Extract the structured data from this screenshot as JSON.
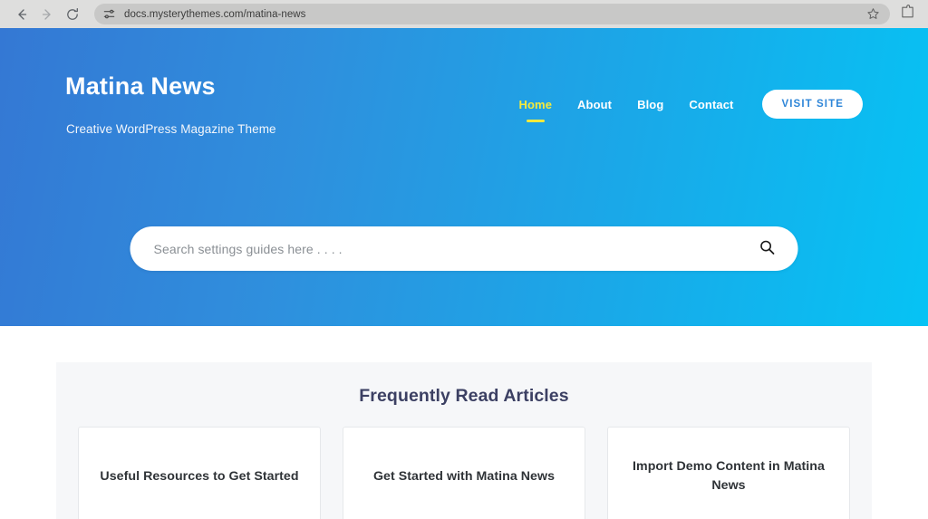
{
  "browser": {
    "back_icon": "back-arrow-icon",
    "forward_icon": "forward-arrow-icon",
    "reload_icon": "reload-icon",
    "site_settings_icon": "site-settings-sliders-icon",
    "url": "docs.mysterythemes.com/matina-news",
    "bookmark_icon": "star-icon",
    "extensions_icon": "extensions-puzzle-icon"
  },
  "hero": {
    "site_title": "Matina News",
    "tagline": "Creative WordPress Magazine Theme",
    "gradient_start": "#3478d4",
    "gradient_end": "#06c3f4",
    "nav": {
      "items": [
        {
          "label": "Home",
          "active": true
        },
        {
          "label": "About",
          "active": false
        },
        {
          "label": "Blog",
          "active": false
        },
        {
          "label": "Contact",
          "active": false
        }
      ],
      "active_color": "#f5ea3c",
      "visit_button_label": "VISIT SITE",
      "visit_button_text_color": "#2f86d8"
    },
    "search": {
      "placeholder": "Search settings guides here . . . .",
      "value": "",
      "icon": "search-magnifier-icon"
    }
  },
  "content": {
    "panel_heading": "Frequently Read Articles",
    "heading_color": "#3c4063",
    "panel_background": "#f6f7f9",
    "articles": [
      {
        "title": "Useful Resources to Get Started"
      },
      {
        "title": "Get Started with Matina News"
      },
      {
        "title": "Import Demo Content in Matina News"
      }
    ]
  }
}
